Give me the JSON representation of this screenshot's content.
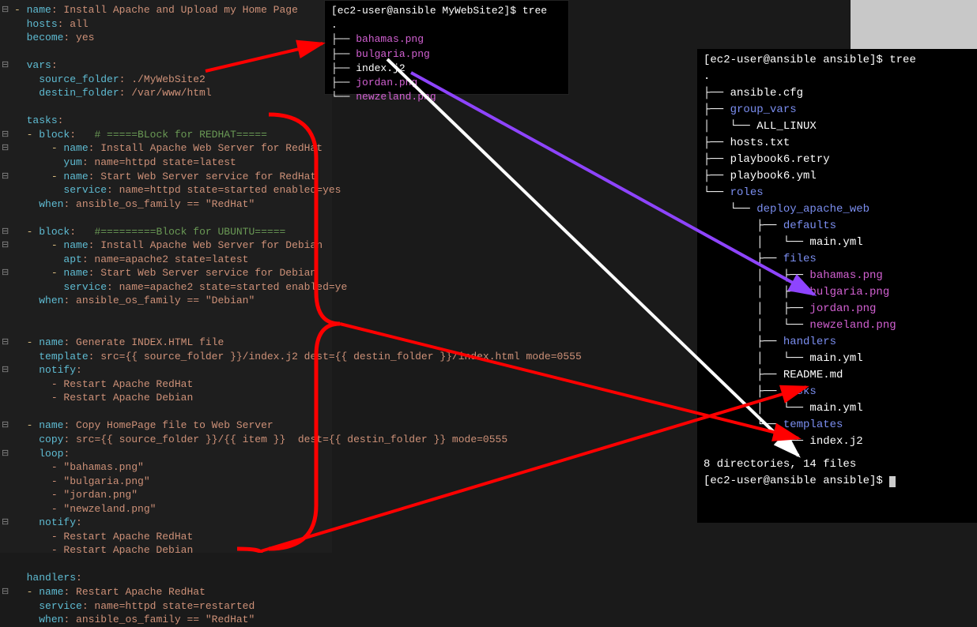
{
  "editor": {
    "l1_dash": "- ",
    "l1_name_k": "name",
    "l1_name_v": ": Install Apache and Upload my Home Page",
    "l2_k": "hosts",
    "l2_v": ": all",
    "l3_k": "become",
    "l3_v": ": yes",
    "l5_k": "vars",
    "l5_v": ":",
    "l6_k": "source_folder",
    "l6_v": ": ./MyWebSite2",
    "l7_k": "destin_folder",
    "l7_v": ": /var/www/html",
    "l9_k": "tasks",
    "l9_v": ":",
    "l10_dash": "- ",
    "l10_k": "block",
    "l10_ccolon": ":   ",
    "l10_c": "# =====BLock for REDHAT=====",
    "l11_dash": "- ",
    "l11_k": "name",
    "l11_v": ": Install Apache Web Server for RedHat",
    "l12_k": "yum",
    "l12_v": ": name=httpd state=latest",
    "l13_dash": "- ",
    "l13_k": "name",
    "l13_v": ": Start Web Server service for RedHat",
    "l14_k": "service",
    "l14_v": ": name=httpd state=started enabled=yes",
    "l15_k": "when",
    "l15_v": ": ansible_os_family == \"RedHat\"",
    "l17_dash": "- ",
    "l17_k": "block",
    "l17_ccolon": ":   ",
    "l17_c": "#=========Block for UBUNTU=====",
    "l18_dash": "- ",
    "l18_k": "name",
    "l18_v": ": Install Apache Web Server for Debian",
    "l19_k": "apt",
    "l19_v": ": name=apache2 state=latest",
    "l20_dash": "- ",
    "l20_k": "name",
    "l20_v": ": Start Web Server service for Debian",
    "l21_k": "service",
    "l21_v": ": name=apache2 state=started enabled=ye",
    "l22_k": "when",
    "l22_v": ": ansible_os_family == \"Debian\"",
    "l25_dash": "- ",
    "l25_k": "name",
    "l25_v": ": Generate INDEX.HTML file",
    "l26_k": "template",
    "l26_v": ": src={{ source_folder }}/index.j2 dest={{ destin_folder }}/index.html mode=0555",
    "l27_k": "notify",
    "l27_v": ":",
    "l28": "- Restart Apache RedHat",
    "l29": "- Restart Apache Debian",
    "l31_dash": "- ",
    "l31_k": "name",
    "l31_v": ": Copy HomePage file to Web Server",
    "l32_k": "copy",
    "l32_v": ": src={{ source_folder }}/{{ item }}  dest={{ destin_folder }} mode=0555",
    "l33_k": "loop",
    "l33_v": ":",
    "l34": "- \"bahamas.png\"",
    "l35": "- \"bulgaria.png\"",
    "l36": "- \"jordan.png\"",
    "l37": "- \"newzeland.png\"",
    "l38_k": "notify",
    "l38_v": ":",
    "l39": "- Restart Apache RedHat",
    "l40": "- Restart Apache Debian",
    "l42_k": "handlers",
    "l42_v": ":",
    "l43_dash": "- ",
    "l43_k": "name",
    "l43_v": ": Restart Apache RedHat",
    "l44_k": "service",
    "l44_v": ": name=httpd state=restarted",
    "l45_k": "when",
    "l45_v": ": ansible_os_family == \"RedHat\""
  },
  "term_small": {
    "prompt": "[ec2-user@ansible MyWebSite2]$ tree",
    "dot": ".",
    "f1": "bahamas.png",
    "f2": "bulgaria.png",
    "f3": "index.j2",
    "f4": "jordan.png",
    "f5": "newzeland.png"
  },
  "term_big": {
    "prompt": "[ec2-user@ansible ansible]$ tree",
    "dot": ".",
    "f1": "ansible.cfg",
    "d1": "group_vars",
    "f2": "ALL_LINUX",
    "f3": "hosts.txt",
    "f4": "playbook6.retry",
    "f5": "playbook6.yml",
    "d2": "roles",
    "d3": "deploy_apache_web",
    "d4": "defaults",
    "f6": "main.yml",
    "d5": "files",
    "f7": "bahamas.png",
    "f8": "bulgaria.png",
    "f9": "jordan.png",
    "f10": "newzeland.png",
    "d6": "handlers",
    "f11": "main.yml",
    "f12": "README.md",
    "d7": "tasks",
    "f13": "main.yml",
    "d8": "templates",
    "f14": "index.j2",
    "summary": "8 directories, 14 files",
    "prompt2": "[ec2-user@ansible ansible]$ "
  }
}
